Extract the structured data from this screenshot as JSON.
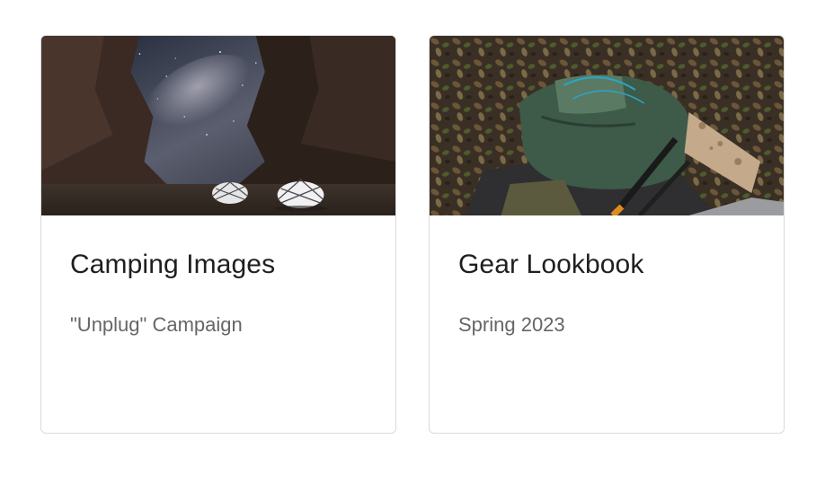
{
  "cards": [
    {
      "title": "Camping Images",
      "subtitle": "\"Unplug\" Campaign",
      "image": "night-desert-camping-photo"
    },
    {
      "title": "Gear Lookbook",
      "subtitle": "Spring 2023",
      "image": "backpack-gear-on-leaves-photo"
    }
  ]
}
